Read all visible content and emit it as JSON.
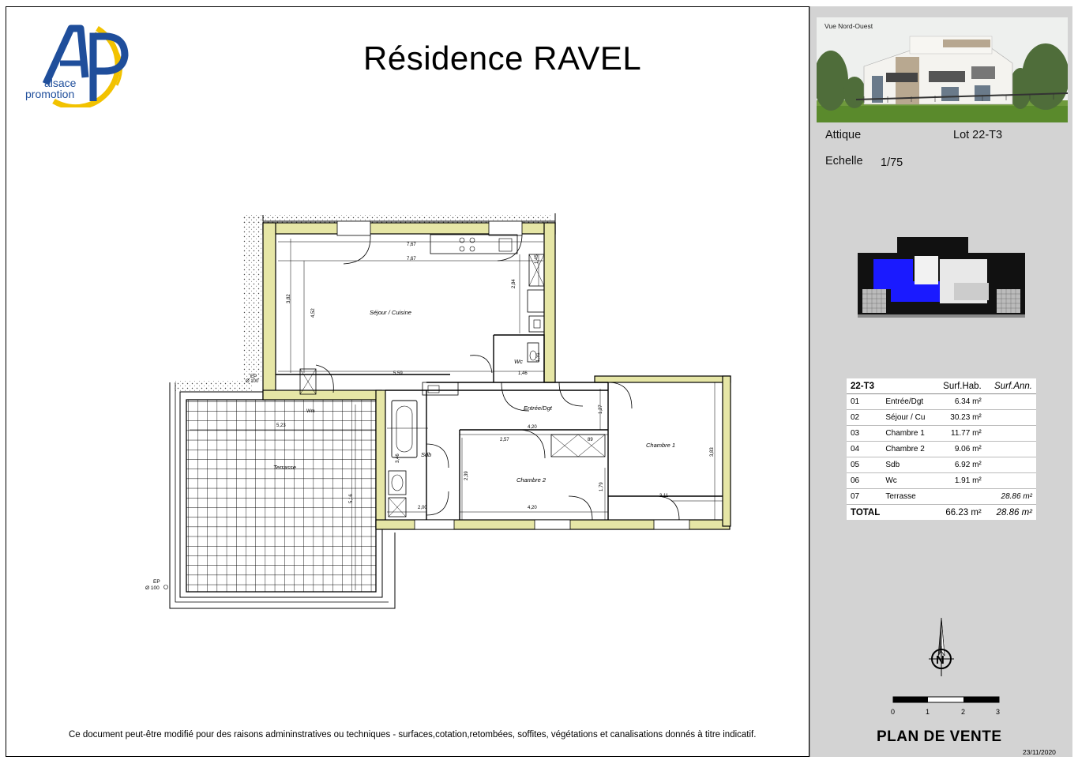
{
  "header": {
    "title": "Résidence RAVEL",
    "logo_line1": "alsace",
    "logo_line2": "promotion"
  },
  "plan": {
    "rooms": {
      "sejour": "Séjour / Cuisine",
      "wc": "Wc",
      "entree": "Entrée/Dgt",
      "sdb": "Sdb",
      "chambre1": "Chambre 1",
      "chambre2": "Chambre 2",
      "terrasse": "Terrasse"
    },
    "dims": {
      "d1": "7,67",
      "d2": "7,67",
      "d3": "3,82",
      "d4": "4,52",
      "d5": "5,59",
      "d6": "1,46",
      "d7": "2,84",
      "d8": "1,45",
      "d9": "1,31",
      "d10": "4,20",
      "d11": "2,57",
      "d12": "89",
      "d13": "1,27",
      "d14": "3,46",
      "d15": "2,39",
      "d16": "1,79",
      "d17": "4,20",
      "d18": "2,00",
      "d19": "3,83",
      "d20": "3,11",
      "d21": "5,23",
      "d22": "5,16"
    },
    "ep_label": "EP",
    "ep_size": "Ø 100",
    "wm_label": "Wm"
  },
  "footer_note": "Ce document peut-être modifié pour des raisons admininstratives ou techniques - surfaces,cotation,retombées, soffites, végétations et canalisations donnés à titre indicatif.",
  "sidebar": {
    "photo_label": "Vue Nord-Ouest",
    "level": "Attique",
    "lot": "Lot 22-T3",
    "scale_label": "Echelle",
    "scale_value": "1/75",
    "table": {
      "header": [
        "22-T3",
        "Surf.Hab.",
        "Surf.Ann."
      ],
      "rows": [
        {
          "num": "01",
          "name": "Entrée/Dgt",
          "hab": "6.34 m²",
          "ann": ""
        },
        {
          "num": "02",
          "name": "Séjour / Cu",
          "hab": "30.23 m²",
          "ann": ""
        },
        {
          "num": "03",
          "name": "Chambre 1",
          "hab": "11.77 m²",
          "ann": ""
        },
        {
          "num": "04",
          "name": "Chambre 2",
          "hab": "9.06 m²",
          "ann": ""
        },
        {
          "num": "05",
          "name": "Sdb",
          "hab": "6.92 m²",
          "ann": ""
        },
        {
          "num": "06",
          "name": "Wc",
          "hab": "1.91 m²",
          "ann": ""
        },
        {
          "num": "07",
          "name": "Terrasse",
          "hab": "",
          "ann": "28.86 m²"
        }
      ],
      "total": {
        "label": "TOTAL",
        "hab": "66.23 m²",
        "ann": "28.86 m²"
      }
    },
    "compass_letter": "N",
    "scale_ticks": [
      "0",
      "1",
      "2",
      "3"
    ],
    "plan_de_vente": "PLAN DE VENTE",
    "date": "23/11/2020"
  },
  "colors": {
    "wall_fill": "#e6e6a6",
    "logo_blue": "#1f4e9b",
    "logo_yellow": "#f2c200",
    "sidebar_bg": "#d3d3d3",
    "minimap_blue": "#1a1aff"
  }
}
